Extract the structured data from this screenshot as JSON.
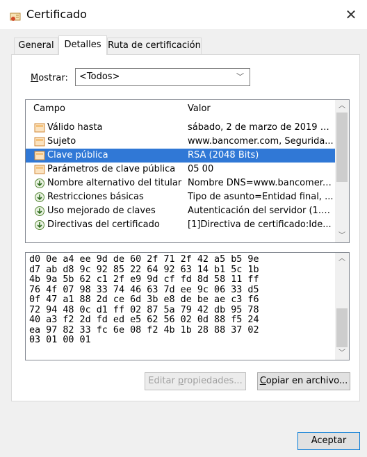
{
  "window": {
    "title": "Certificado",
    "icon": "certificate-icon",
    "close_icon": "close-icon"
  },
  "tabs": [
    {
      "label": "General",
      "active": false
    },
    {
      "label": "Detalles",
      "active": true
    },
    {
      "label": "Ruta de certificación",
      "active": false
    }
  ],
  "show": {
    "label_accel": "M",
    "label_rest": "ostrar:",
    "selected": "<Todos>"
  },
  "fields": {
    "headers": {
      "campo": "Campo",
      "valor": "Valor"
    },
    "rows": [
      {
        "name": "Válido hasta",
        "value": "sábado, 2 de marzo de 2019 0...",
        "icon": "field-icon",
        "selected": false
      },
      {
        "name": "Sujeto",
        "value": "www.bancomer.com, Segurida...",
        "icon": "field-icon",
        "selected": false
      },
      {
        "name": "Clave pública",
        "value": "RSA (2048 Bits)",
        "icon": "field-icon",
        "selected": true
      },
      {
        "name": "Parámetros de clave pública",
        "value": "05 00",
        "icon": "field-icon",
        "selected": false
      },
      {
        "name": "Nombre alternativo del titular",
        "value": "Nombre DNS=www.bancomer....",
        "icon": "extension-icon",
        "selected": false
      },
      {
        "name": "Restricciones básicas",
        "value": "Tipo de asunto=Entidad final, ...",
        "icon": "extension-icon",
        "selected": false
      },
      {
        "name": "Uso mejorado de claves",
        "value": "Autenticación del servidor (1.3...",
        "icon": "extension-icon",
        "selected": false
      },
      {
        "name": "Directivas del certificado",
        "value": "[1]Directiva de certificado:Ide...",
        "icon": "extension-icon",
        "selected": false
      }
    ]
  },
  "hex_value": "d0 0e a4 ee 9d de 60 2f 71 2f 42 a5 b5 9e\nd7 ab d8 9c 92 85 22 64 92 63 14 b1 5c 1b\n4b 9a 5b 62 c1 2f e9 9d cf fd 8d 58 11 ff\n76 4f 07 98 33 74 46 63 7d ee 9c 06 33 d5\n0f 47 a1 88 2d ce 6d 3b e8 de be ae c3 f6\n72 94 48 0c d1 ff 02 87 5a 79 42 db 95 78\n40 a3 f2 2d fd ed e5 62 56 02 0d 88 f5 24\nea 97 82 33 fc 6e 08 f2 4b 1b 28 88 37 02\n03 01 00 01",
  "buttons": {
    "edit": {
      "label_pre": "Editar ",
      "label_accel": "p",
      "label_post": "ropiedades...",
      "disabled": true
    },
    "copy": {
      "label_accel": "C",
      "label_post": "opiar en archivo...",
      "disabled": false
    },
    "accept": {
      "label": "Aceptar"
    }
  },
  "colors": {
    "selection": "#3078d6",
    "accept_border": "#0078d7"
  }
}
